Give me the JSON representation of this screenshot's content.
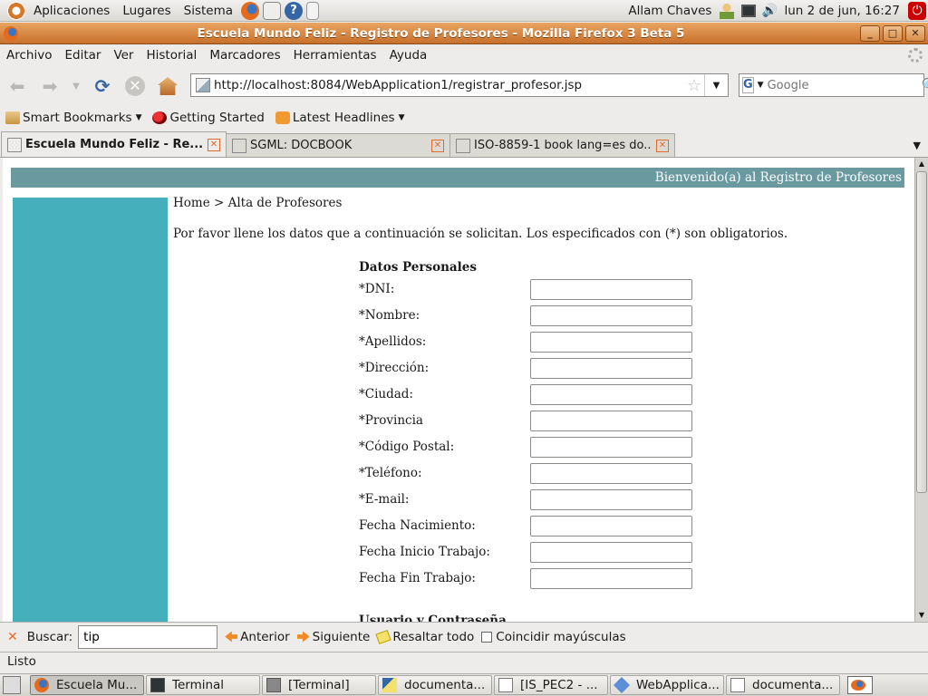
{
  "top_panel": {
    "menus": [
      "Aplicaciones",
      "Lugares",
      "Sistema"
    ],
    "user": "Allam Chaves",
    "datetime": "lun  2 de jun, 16:27"
  },
  "window": {
    "title": "Escuela Mundo Feliz - Registro de Profesores - Mozilla Firefox 3 Beta 5"
  },
  "menubar": [
    "Archivo",
    "Editar",
    "Ver",
    "Historial",
    "Marcadores",
    "Herramientas",
    "Ayuda"
  ],
  "navbar": {
    "url": "http://localhost:8084/WebApplication1/registrar_profesor.jsp",
    "search_placeholder": "Google"
  },
  "bookmarks": [
    {
      "label": "Smart Bookmarks",
      "icon": "folder-icon"
    },
    {
      "label": "Getting Started",
      "icon": "firefox-icon"
    },
    {
      "label": "Latest Headlines",
      "icon": "rss-icon"
    }
  ],
  "tabs": [
    {
      "label": "Escuela Mundo Feliz - Re...",
      "active": true
    },
    {
      "label": "SGML: DOCBOOK",
      "active": false
    },
    {
      "label": "ISO-8859-1 book lang=es do...",
      "active": false
    }
  ],
  "page": {
    "welcome": "Bienvenido(a) al Registro de Profesores",
    "breadcrumb": "Home > Alta de Profesores",
    "intro": "Por favor llene los datos que a continuación se solicitan. Los especificados con (*) son obligatorios.",
    "section_title": "Datos Personales",
    "fields": [
      {
        "label": "*DNI:",
        "value": ""
      },
      {
        "label": "*Nombre:",
        "value": ""
      },
      {
        "label": "*Apellidos:",
        "value": ""
      },
      {
        "label": "*Dirección:",
        "value": ""
      },
      {
        "label": "*Ciudad:",
        "value": ""
      },
      {
        "label": "*Provincia",
        "value": ""
      },
      {
        "label": "*Código Postal:",
        "value": ""
      },
      {
        "label": "*Teléfono:",
        "value": ""
      },
      {
        "label": "*E-mail:",
        "value": ""
      },
      {
        "label": "Fecha Nacimiento:",
        "value": ""
      },
      {
        "label": "Fecha Inicio Trabajo:",
        "value": ""
      },
      {
        "label": "Fecha Fin Trabajo:",
        "value": ""
      }
    ],
    "next_section_title": "Usuario y Contraseña"
  },
  "findbar": {
    "label": "Buscar:",
    "value": "tip",
    "prev": "Anterior",
    "next": "Siguiente",
    "highlight": "Resaltar todo",
    "match_case": "Coincidir mayúsculas"
  },
  "status": "Listo",
  "taskbar": [
    {
      "label": "Escuela Mu...",
      "icon": "firefox-icon"
    },
    {
      "label": "Terminal",
      "icon": "terminal-icon"
    },
    {
      "label": "[Terminal]",
      "icon": "terminal-icon"
    },
    {
      "label": "documenta...",
      "icon": "editor-icon"
    },
    {
      "label": "[IS_PEC2 - ...",
      "icon": "document-icon"
    },
    {
      "label": "WebApplica...",
      "icon": "netbeans-icon"
    },
    {
      "label": "documenta...",
      "icon": "document-icon"
    }
  ]
}
